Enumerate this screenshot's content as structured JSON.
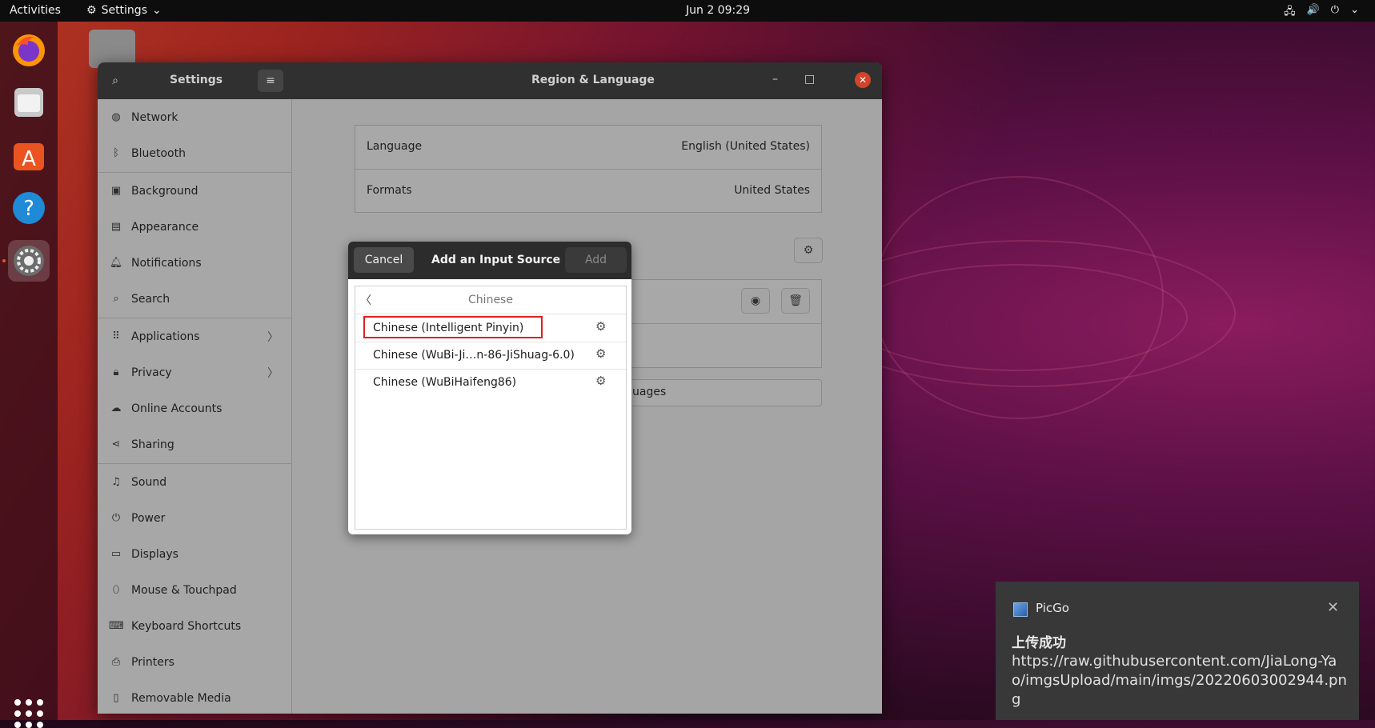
{
  "topbar": {
    "activities": "Activities",
    "app_menu": "Settings",
    "clock": "Jun 2  09:29"
  },
  "window": {
    "sidebar_title": "Settings",
    "title": "Region & Language"
  },
  "sidebar": {
    "items": [
      {
        "label": "Network",
        "icon": "network-icon"
      },
      {
        "label": "Bluetooth",
        "icon": "bluetooth-icon"
      },
      {
        "label": "Background",
        "icon": "background-icon"
      },
      {
        "label": "Appearance",
        "icon": "appearance-icon"
      },
      {
        "label": "Notifications",
        "icon": "bell-icon"
      },
      {
        "label": "Search",
        "icon": "search-icon"
      },
      {
        "label": "Applications",
        "icon": "apps-icon"
      },
      {
        "label": "Privacy",
        "icon": "lock-icon"
      },
      {
        "label": "Online Accounts",
        "icon": "cloud-icon"
      },
      {
        "label": "Sharing",
        "icon": "share-icon"
      },
      {
        "label": "Sound",
        "icon": "music-icon"
      },
      {
        "label": "Power",
        "icon": "power-icon"
      },
      {
        "label": "Displays",
        "icon": "display-icon"
      },
      {
        "label": "Mouse & Touchpad",
        "icon": "mouse-icon"
      },
      {
        "label": "Keyboard Shortcuts",
        "icon": "keyboard-icon"
      },
      {
        "label": "Printers",
        "icon": "printer-icon"
      },
      {
        "label": "Removable Media",
        "icon": "usb-icon"
      }
    ]
  },
  "region": {
    "language_label": "Language",
    "language_value": "English (United States)",
    "formats_label": "Formats",
    "formats_value": "United States",
    "manage_partial": "uages"
  },
  "dialog": {
    "cancel": "Cancel",
    "title": "Add an Input Source",
    "add": "Add",
    "category": "Chinese",
    "sources": [
      "Chinese (Intelligent Pinyin)",
      "Chinese (WuBi-Ji…n-86-JiShuag-6.0)",
      "Chinese (WuBiHaifeng86)"
    ]
  },
  "notification": {
    "app": "PicGo",
    "title": "上传成功",
    "body": "https://raw.githubusercontent.com/JiaLong-Yao/imgsUpload/main/imgs/20220603002944.png"
  },
  "colors": {
    "accent": "#e95420",
    "highlight": "#e02020"
  }
}
